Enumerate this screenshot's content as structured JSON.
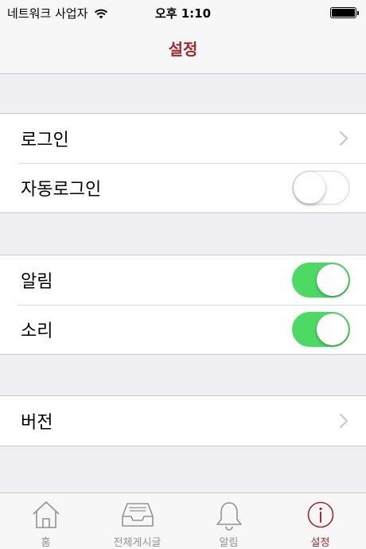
{
  "status_bar": {
    "carrier": "네트워크 사업자",
    "time": "오후 1:10",
    "wifi_icon": "wifi-icon",
    "battery_icon": "battery-icon"
  },
  "nav": {
    "title": "설정"
  },
  "groups": [
    {
      "rows": [
        {
          "label": "로그인",
          "accessory": "chevron-right-icon"
        },
        {
          "label": "자동로그인",
          "accessory": "toggle",
          "on": false
        }
      ]
    },
    {
      "rows": [
        {
          "label": "알림",
          "accessory": "toggle",
          "on": true
        },
        {
          "label": "소리",
          "accessory": "toggle",
          "on": true
        }
      ]
    },
    {
      "rows": [
        {
          "label": "버전",
          "accessory": "chevron-right-icon"
        }
      ]
    }
  ],
  "tabs": [
    {
      "label": "홈",
      "icon": "home-icon"
    },
    {
      "label": "전체게시글",
      "icon": "inbox-icon"
    },
    {
      "label": "알림",
      "icon": "bell-icon"
    },
    {
      "label": "설정",
      "icon": "info-icon",
      "active": true
    }
  ],
  "colors": {
    "accent": "#a02a2f",
    "toggle_on": "#4cd964",
    "tab_inactive": "#929292",
    "background": "#efeff4"
  }
}
